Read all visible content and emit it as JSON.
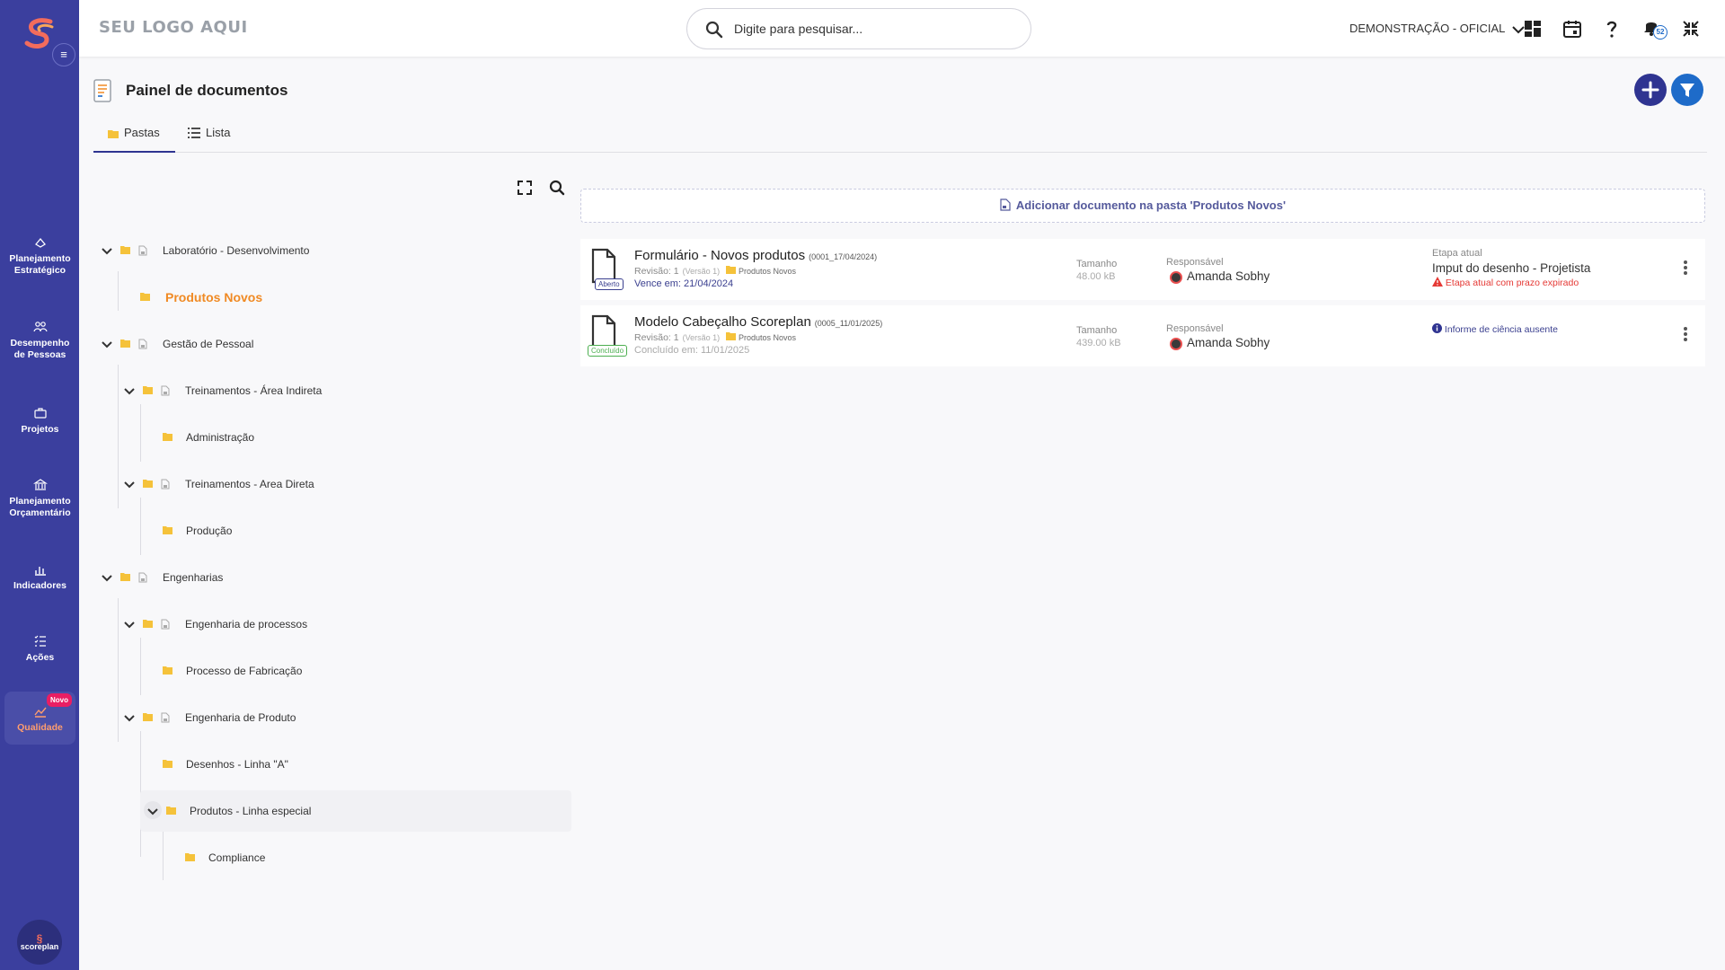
{
  "colors": {
    "sidebar": "#3b3f9e",
    "accent": "#2f3491",
    "primary_blue": "#1e6bc9",
    "selected_folder": "#f08a24",
    "folder": "#f5c23a",
    "danger": "#e53935",
    "success": "#4caf50"
  },
  "sidebar": {
    "items": [
      {
        "label": "Planejamento Estratégico",
        "icon": "strategy-icon"
      },
      {
        "label": "Desempenho de Pessoas",
        "icon": "people-icon"
      },
      {
        "label": "Projetos",
        "icon": "briefcase-icon"
      },
      {
        "label": "Planejamento Orçamentário",
        "icon": "bank-icon"
      },
      {
        "label": "Indicadores",
        "icon": "bar-chart-icon"
      },
      {
        "label": "Ações",
        "icon": "checklist-icon"
      },
      {
        "label": "Qualidade",
        "icon": "trend-icon",
        "badge": "Novo"
      }
    ],
    "brand": "scoreplan"
  },
  "topbar": {
    "logo_placeholder": "SEU LOGO AQUI",
    "search_placeholder": "Digite para pesquisar...",
    "company": "DEMONSTRAÇÃO - OFICIAL",
    "notifications_count": "52"
  },
  "page": {
    "title": "Painel de documentos",
    "tabs": [
      {
        "label": "Pastas"
      },
      {
        "label": "Lista"
      }
    ]
  },
  "tree": {
    "nodes": [
      {
        "label": "Laboratório - Desenvolvimento"
      },
      {
        "label": "Produtos Novos"
      },
      {
        "label": "Gestão de Pessoal"
      },
      {
        "label": "Treinamentos - Área Indireta"
      },
      {
        "label": "Administração"
      },
      {
        "label": "Treinamentos - Area Direta"
      },
      {
        "label": "Produção"
      },
      {
        "label": "Engenharias"
      },
      {
        "label": "Engenharia de processos"
      },
      {
        "label": "Processo de Fabricação"
      },
      {
        "label": "Engenharia de Produto"
      },
      {
        "label": "Desenhos - Linha \"A\""
      },
      {
        "label": "Produtos - Linha especial"
      },
      {
        "label": "Compliance"
      }
    ]
  },
  "documents": {
    "add_label": "Adicionar documento na pasta 'Produtos Novos'",
    "size_label": "Tamanho",
    "responsible_label": "Responsável",
    "items": [
      {
        "title": "Formulário - Novos produtos",
        "code": "(0001_17/04/2024)",
        "revision": "Revisão: 1",
        "version": "(Versão 1)",
        "folder": "Produtos Novos",
        "status": "Aberto",
        "due": "Vence em: 21/04/2024",
        "size": "48.00 kB",
        "responsible": "Amanda Sobhy",
        "stage_label": "Etapa atual",
        "stage": "Imput do desenho - Projetista",
        "stage_warning": "Etapa atual com prazo expirado"
      },
      {
        "title": "Modelo Cabeçalho Scoreplan",
        "code": "(0005_11/01/2025)",
        "revision": "Revisão: 1",
        "version": "(Versão 1)",
        "folder": "Produtos Novos",
        "status": "Concluído",
        "due": "Concluído em: 11/01/2025",
        "size": "439.00 kB",
        "responsible": "Amanda Sobhy",
        "info": "Informe de ciência ausente"
      }
    ]
  }
}
